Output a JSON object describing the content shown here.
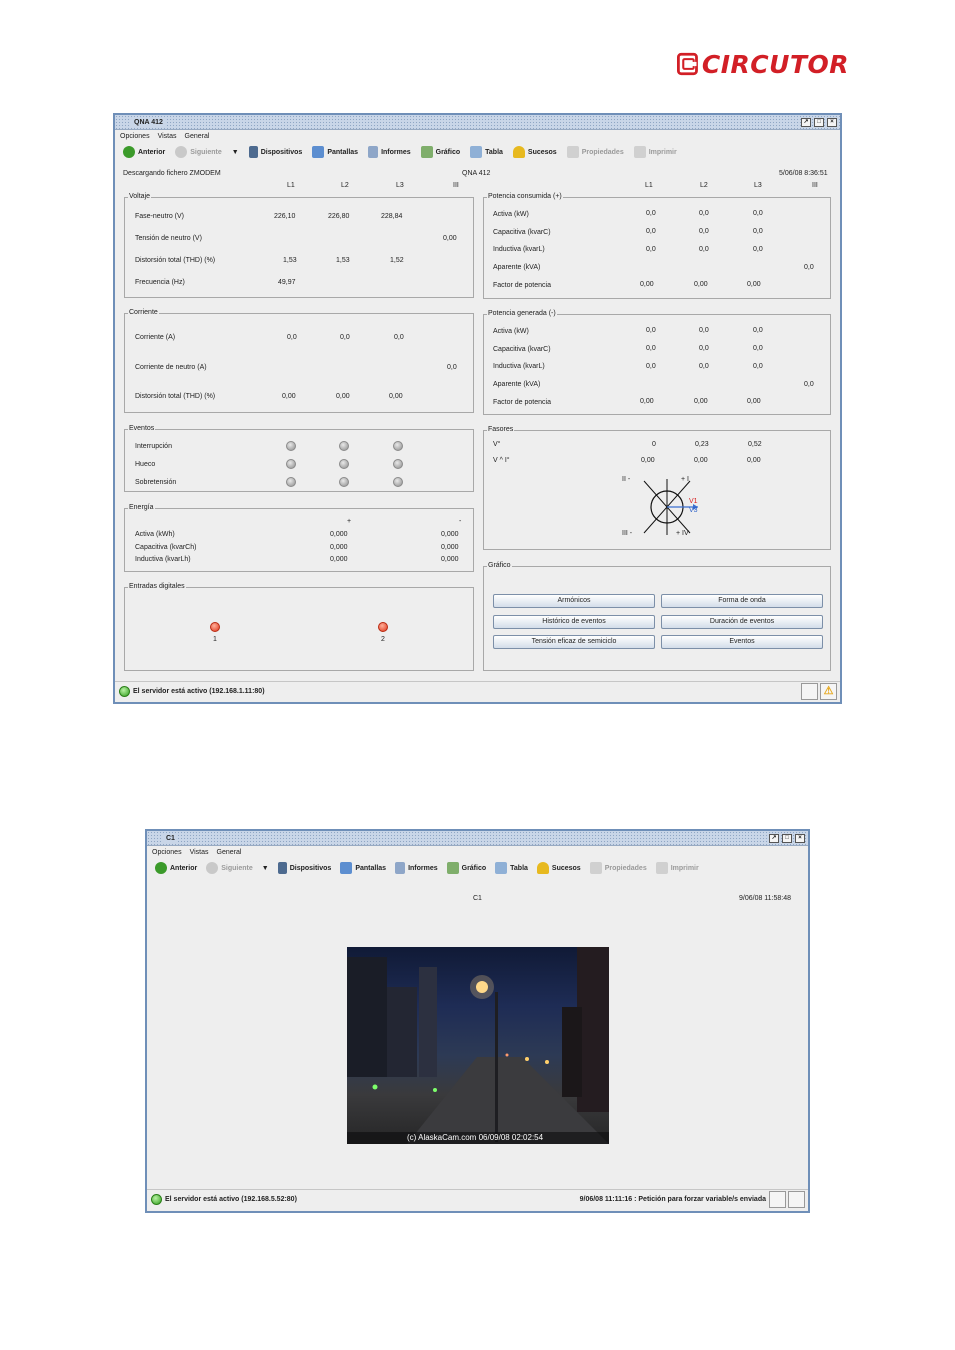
{
  "brand": {
    "logo_text": "CIRCUTOR",
    "color": "#d21f26"
  },
  "colors": {
    "window_border": "#6f8fb8",
    "window_bg": "#eeeeee",
    "status_green": "#2f9d1c",
    "led_red": "#e0371c"
  },
  "toolbar": {
    "back": "Anterior",
    "next": "Siguiente",
    "devices": "Dispositivos",
    "screens": "Pantallas",
    "reports": "Informes",
    "graph": "Gráfico",
    "table": "Tabla",
    "events": "Sucesos",
    "properties": "Propiedades",
    "print": "Imprimir"
  },
  "menu": {
    "options": "Opciones",
    "views": "Vistas",
    "general": "General"
  },
  "window1": {
    "title": "QNA 412",
    "download_status": "Descargando fichero ZMODEM",
    "device": "QNA 412",
    "datetime": "5/06/08 8:36:51",
    "phase_headers": [
      "L1",
      "L2",
      "L3",
      "III"
    ],
    "voltage": {
      "label": "Voltaje",
      "rows": [
        {
          "name": "Fase-neutro (V)",
          "l1": "226,10",
          "l2": "226,80",
          "l3": "228,84",
          "iii": ""
        },
        {
          "name": "Tensión de neutro (V)",
          "l1": "",
          "l2": "",
          "l3": "",
          "iii": "0,00"
        },
        {
          "name": "Distorsión total (THD) (%)",
          "l1": "1,53",
          "l2": "1,53",
          "l3": "1,52",
          "iii": ""
        },
        {
          "name": "Frecuencia (Hz)",
          "l1": "49,97",
          "l2": "",
          "l3": "",
          "iii": ""
        }
      ]
    },
    "current": {
      "label": "Corriente",
      "rows": [
        {
          "name": "Corriente (A)",
          "l1": "0,0",
          "l2": "0,0",
          "l3": "0,0",
          "iii": ""
        },
        {
          "name": "Corriente de neutro (A)",
          "l1": "",
          "l2": "",
          "l3": "",
          "iii": "0,0"
        },
        {
          "name": "Distorsión total (THD) (%)",
          "l1": "0,00",
          "l2": "0,00",
          "l3": "0,00",
          "iii": ""
        }
      ]
    },
    "events": {
      "label": "Eventos",
      "rows": [
        "Interrupción",
        "Hueco",
        "Sobretensión"
      ]
    },
    "energy": {
      "label": "Energía",
      "plus": "+",
      "minus": "-",
      "rows": [
        {
          "name": "Activa (kWh)",
          "pos": "0,000",
          "neg": "0,000"
        },
        {
          "name": "Capacitiva (kvarCh)",
          "pos": "0,000",
          "neg": "0,000"
        },
        {
          "name": "Inductiva (kvarLh)",
          "pos": "0,000",
          "neg": "0,000"
        }
      ]
    },
    "digital_inputs": {
      "label": "Entradas digitales",
      "items": [
        "1",
        "2"
      ]
    },
    "power_consumed": {
      "label": "Potencia consumida (+)",
      "rows": [
        {
          "name": "Activa (kW)",
          "l1": "0,0",
          "l2": "0,0",
          "l3": "0,0",
          "iii": ""
        },
        {
          "name": "Capacitiva (kvarC)",
          "l1": "0,0",
          "l2": "0,0",
          "l3": "0,0",
          "iii": ""
        },
        {
          "name": "Inductiva (kvarL)",
          "l1": "0,0",
          "l2": "0,0",
          "l3": "0,0",
          "iii": ""
        },
        {
          "name": "Aparente (kVA)",
          "l1": "",
          "l2": "",
          "l3": "",
          "iii": "0,0"
        },
        {
          "name": "Factor de potencia",
          "l1": "0,00",
          "l2": "0,00",
          "l3": "0,00",
          "iii": ""
        }
      ]
    },
    "power_generated": {
      "label": "Potencia generada (-)",
      "rows": [
        {
          "name": "Activa (kW)",
          "l1": "0,0",
          "l2": "0,0",
          "l3": "0,0",
          "iii": ""
        },
        {
          "name": "Capacitiva (kvarC)",
          "l1": "0,0",
          "l2": "0,0",
          "l3": "0,0",
          "iii": ""
        },
        {
          "name": "Inductiva (kvarL)",
          "l1": "0,0",
          "l2": "0,0",
          "l3": "0,0",
          "iii": ""
        },
        {
          "name": "Aparente (kVA)",
          "l1": "",
          "l2": "",
          "l3": "",
          "iii": "0,0"
        },
        {
          "name": "Factor de potencia",
          "l1": "0,00",
          "l2": "0,00",
          "l3": "0,00",
          "iii": ""
        }
      ]
    },
    "phasors": {
      "label": "Fasores",
      "rows": [
        {
          "name": "V°",
          "l1": "0",
          "l2": "0,23",
          "l3": "0,52"
        },
        {
          "name": "V ^ I°",
          "l1": "0,00",
          "l2": "0,00",
          "l3": "0,00"
        }
      ],
      "quadrants": {
        "q2": "II -",
        "q1": "+ I",
        "q3": "III -",
        "q4": "+ IV"
      },
      "vectors": {
        "v1": "V1",
        "v3": "V3"
      }
    },
    "graph": {
      "label": "Gráfico",
      "buttons": [
        "Armónicos",
        "Forma de onda",
        "Histórico de eventos",
        "Duración de eventos",
        "Tensión eficaz de semiciclo",
        "Eventos"
      ]
    },
    "status": "El servidor está activo (192.168.1.11:80)"
  },
  "window2": {
    "title": "C1",
    "camera_name": "C1",
    "datetime": "9/06/08 11:58:48",
    "camera_caption": "(c) AlaskaCam.com 06/09/08 02:02:54",
    "status": "El servidor está activo (192.168.5.52:80)",
    "status_right": "9/06/08 11:11:16 : Petición para forzar variable/s enviada"
  }
}
